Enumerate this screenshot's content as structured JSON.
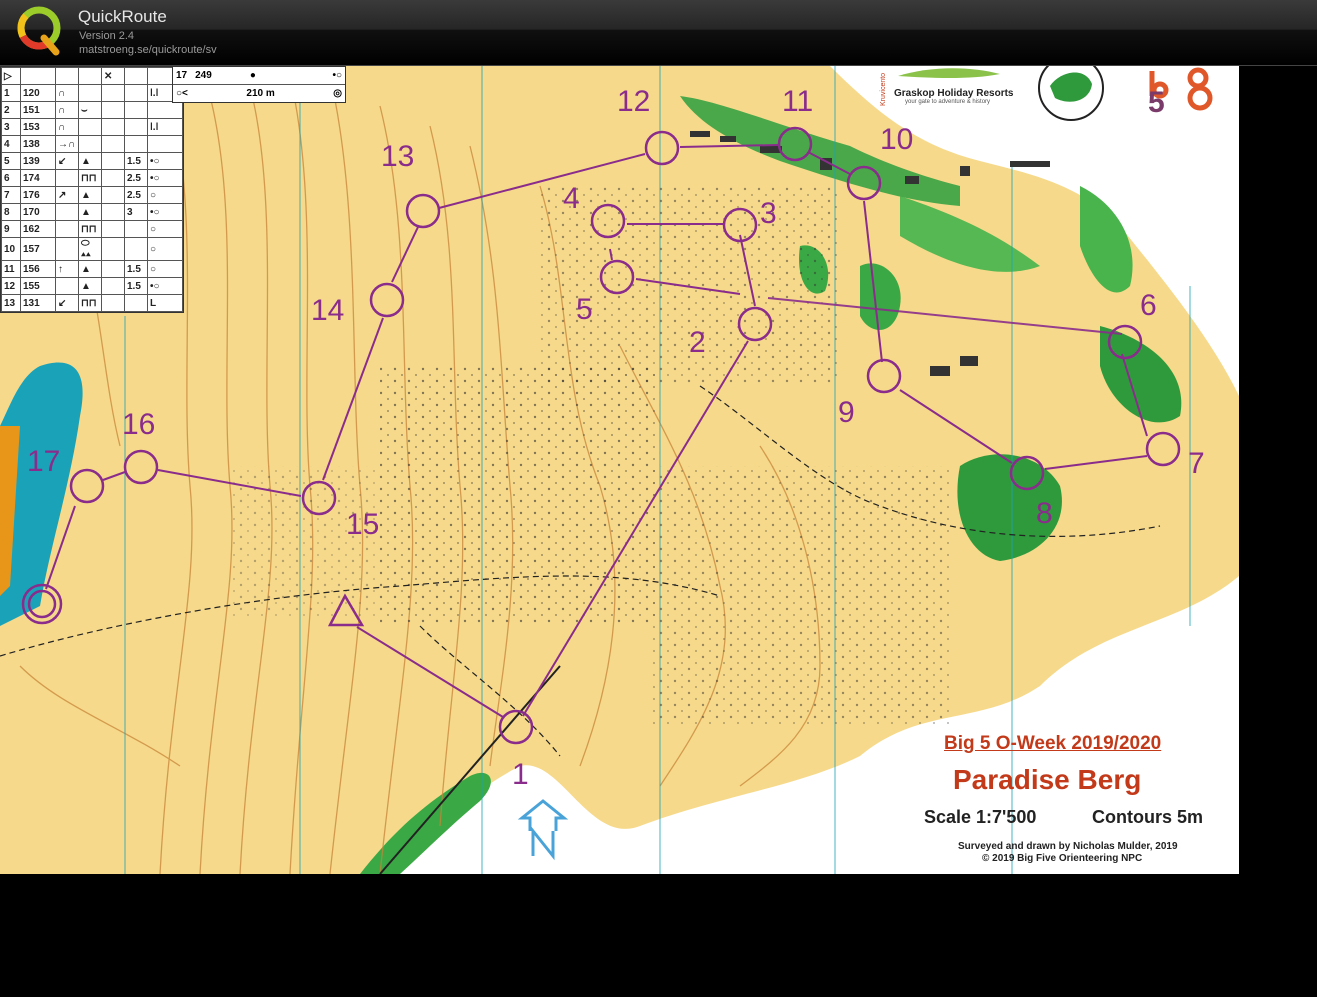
{
  "window": {
    "app_name": "QuickRoute",
    "version": "Version 2.4",
    "url": "matstroeng.se/quickroute/sv",
    "logo_letter": "Q"
  },
  "map": {
    "event_title": "Big 5 O-Week 2019/2020",
    "map_name": "Paradise Berg",
    "scale": "Scale 1:7'500",
    "contours": "Contours 5m",
    "credit_surveyed": "Surveyed and drawn by Nicholas Mulder, 2019",
    "credit_copyright": "© 2019 Big Five Orienteering NPC",
    "sponsor": "Graskop Holiday Resorts",
    "sponsor_tagline": "your gate to adventure & history",
    "big5_logo": "big 5",
    "course_color": "#8a2c8c",
    "controls": [
      {
        "num": "1"
      },
      {
        "num": "2"
      },
      {
        "num": "3"
      },
      {
        "num": "4"
      },
      {
        "num": "5"
      },
      {
        "num": "6"
      },
      {
        "num": "7"
      },
      {
        "num": "8"
      },
      {
        "num": "9"
      },
      {
        "num": "10"
      },
      {
        "num": "11"
      },
      {
        "num": "12"
      },
      {
        "num": "13"
      },
      {
        "num": "14"
      },
      {
        "num": "15"
      },
      {
        "num": "16"
      },
      {
        "num": "17"
      }
    ]
  },
  "descriptions": {
    "rows": [
      {
        "n": "1",
        "code": "120",
        "feature": "∩",
        "detail": "",
        "size": "",
        "extra": "ǀ.ǀ"
      },
      {
        "n": "2",
        "code": "151",
        "feature": "∩",
        "detail": "⌣",
        "size": "",
        "extra": ""
      },
      {
        "n": "3",
        "code": "153",
        "feature": "∩",
        "detail": "",
        "size": "",
        "extra": "ǀ.ǀ"
      },
      {
        "n": "4",
        "code": "138",
        "feature": "→∩",
        "detail": "",
        "size": "",
        "extra": ""
      },
      {
        "n": "5",
        "code": "139",
        "feature": "↙",
        "detail": "▲",
        "size": "1.5",
        "extra": "•○"
      },
      {
        "n": "6",
        "code": "174",
        "feature": "",
        "detail": "⊓⊓",
        "size": "2.5",
        "extra": "•○"
      },
      {
        "n": "7",
        "code": "176",
        "feature": "↗",
        "detail": "▲",
        "size": "2.5",
        "extra": "○"
      },
      {
        "n": "8",
        "code": "170",
        "feature": "",
        "detail": "▲",
        "size": "3",
        "extra": "•○"
      },
      {
        "n": "9",
        "code": "162",
        "feature": "",
        "detail": "⊓⊓",
        "size": "",
        "extra": "○"
      },
      {
        "n": "10",
        "code": "157",
        "feature": "",
        "detail": "⬭ ▴▴",
        "size": "",
        "extra": "○"
      },
      {
        "n": "11",
        "code": "156",
        "feature": "↑",
        "detail": "▲",
        "size": "1.5",
        "extra": "○"
      },
      {
        "n": "12",
        "code": "155",
        "feature": "",
        "detail": "▲",
        "size": "1.5",
        "extra": "•○"
      },
      {
        "n": "13",
        "code": "131",
        "feature": "↙",
        "detail": "⊓⊓",
        "size": "",
        "extra": "L"
      }
    ],
    "row17": {
      "n": "17",
      "code": "249",
      "feature": "●",
      "extra": "•○"
    },
    "finish_distance": "210 m"
  }
}
